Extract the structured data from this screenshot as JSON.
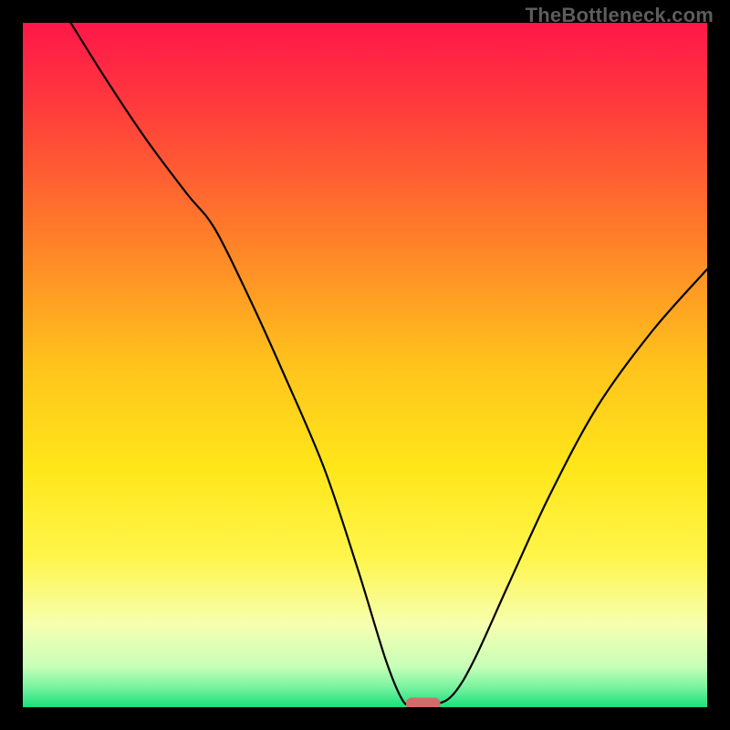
{
  "watermark": "TheBottleneck.com",
  "chart_data": {
    "type": "line",
    "title": "",
    "xlabel": "",
    "ylabel": "",
    "x_range": [
      0,
      100
    ],
    "y_range": [
      0,
      100
    ],
    "grid": false,
    "legend": false,
    "gradient_stops": [
      {
        "offset": 0.0,
        "color": "#ff1749"
      },
      {
        "offset": 0.12,
        "color": "#ff3a3d"
      },
      {
        "offset": 0.3,
        "color": "#ff7a2a"
      },
      {
        "offset": 0.5,
        "color": "#ffc31c"
      },
      {
        "offset": 0.65,
        "color": "#ffe61a"
      },
      {
        "offset": 0.78,
        "color": "#fff54a"
      },
      {
        "offset": 0.88,
        "color": "#f6ffb0"
      },
      {
        "offset": 0.94,
        "color": "#c8ffb8"
      },
      {
        "offset": 0.97,
        "color": "#7bf3a0"
      },
      {
        "offset": 1.0,
        "color": "#19e07b"
      }
    ],
    "curve": {
      "name": "bottleneck-curve",
      "color": "#000000",
      "stroke_width": 2.2,
      "x": [
        7.0,
        12.0,
        18.0,
        24.0,
        28.0,
        33.0,
        38.0,
        44.0,
        49.0,
        53.0,
        55.5,
        57.0,
        60.5,
        63.0,
        66.0,
        71.0,
        77.0,
        84.0,
        92.0,
        100.0
      ],
      "y": [
        100.0,
        92.0,
        83.0,
        75.0,
        70.0,
        60.0,
        49.0,
        35.0,
        20.0,
        7.0,
        1.0,
        0.5,
        0.5,
        2.0,
        7.0,
        18.0,
        31.0,
        44.0,
        55.0,
        64.0
      ]
    },
    "optimum_marker": {
      "x": 58.5,
      "y": 0.5,
      "width": 5.0,
      "height": 1.8,
      "color": "#d46a6a"
    }
  }
}
